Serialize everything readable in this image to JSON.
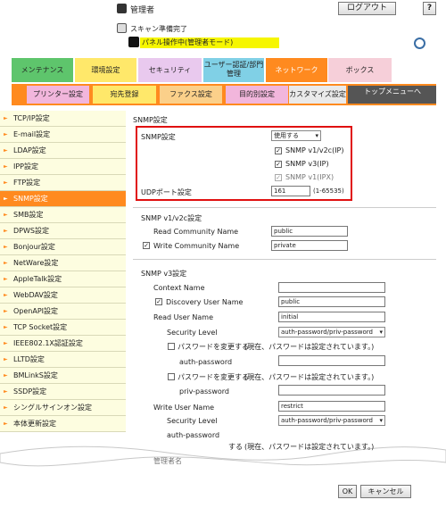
{
  "header": {
    "admin_label": "管理者",
    "logout_label": "ログアウト",
    "help_label": "?",
    "scan_status": "スキャン準備完了",
    "panel_status": "パネル操作中(管理者モード)"
  },
  "main_tabs": [
    {
      "label": "メンテナンス"
    },
    {
      "label": "環境設定"
    },
    {
      "label": "セキュリティ"
    },
    {
      "label": "ユーザー認証/部門管理"
    },
    {
      "label": "ネットワーク"
    },
    {
      "label": "ボックス"
    }
  ],
  "sub_tabs": [
    {
      "label": "プリンター設定"
    },
    {
      "label": "宛先登録"
    },
    {
      "label": "ファクス設定"
    },
    {
      "label": "目的別設定"
    },
    {
      "label": "カスタマイズ設定"
    },
    {
      "label": "トップメニューへ"
    }
  ],
  "sidebar": {
    "items": [
      {
        "label": "TCP/IP設定"
      },
      {
        "label": "E-mail設定"
      },
      {
        "label": "LDAP設定"
      },
      {
        "label": "IPP設定"
      },
      {
        "label": "FTP設定"
      },
      {
        "label": "SNMP設定"
      },
      {
        "label": "SMB設定"
      },
      {
        "label": "DPWS設定"
      },
      {
        "label": "Bonjour設定"
      },
      {
        "label": "NetWare設定"
      },
      {
        "label": "AppleTalk設定"
      },
      {
        "label": "WebDAV設定"
      },
      {
        "label": "OpenAPI設定"
      },
      {
        "label": "TCP Socket設定"
      },
      {
        "label": "IEEE802.1X認証設定"
      },
      {
        "label": "LLTD設定"
      },
      {
        "label": "BMLinkS設定"
      },
      {
        "label": "SSDP設定"
      },
      {
        "label": "シングルサインオン設定"
      },
      {
        "label": "本体更新設定"
      }
    ],
    "active_index": 5
  },
  "snmp": {
    "title": "SNMP設定",
    "setting_label": "SNMP設定",
    "setting_value": "使用する",
    "v1v2c_ip_label": "SNMP v1/v2c(IP)",
    "v3_ip_label": "SNMP v3(IP)",
    "v1_ipx_label": "SNMP v1(IPX)",
    "udp_label": "UDPポート設定",
    "udp_value": "161",
    "udp_range": "(1-65535)"
  },
  "v1v2c": {
    "title": "SNMP v1/v2c設定",
    "read_label": "Read Community Name",
    "read_value": "public",
    "write_label": "Write Community Name",
    "write_value": "private"
  },
  "v3": {
    "title": "SNMP v3設定",
    "context_label": "Context Name",
    "context_value": "",
    "discovery_label": "Discovery User Name",
    "discovery_value": "public",
    "read_user_label": "Read User Name",
    "read_user_value": "initial",
    "sec_level_label": "Security Level",
    "sec_level_value": "auth-password/priv-password",
    "change_pw_label": "パスワードを変更する",
    "pw_note": "(現在、パスワードは設定されています。)",
    "auth_pw_label": "auth-password",
    "priv_pw_label": "priv-password",
    "write_user_label": "Write User Name",
    "write_user_value": "restrict",
    "sec_level2_label": "Security Level",
    "sec_level2_value": "auth-password/priv-password",
    "auth_pw2_label": "auth-password",
    "partial_change_label": "する",
    "partial_note": "(現在、パスワードは設定されています。)",
    "partial_admin_label": "管理者名"
  },
  "footer": {
    "ok_label": "OK",
    "cancel_label": "キャンセル"
  }
}
